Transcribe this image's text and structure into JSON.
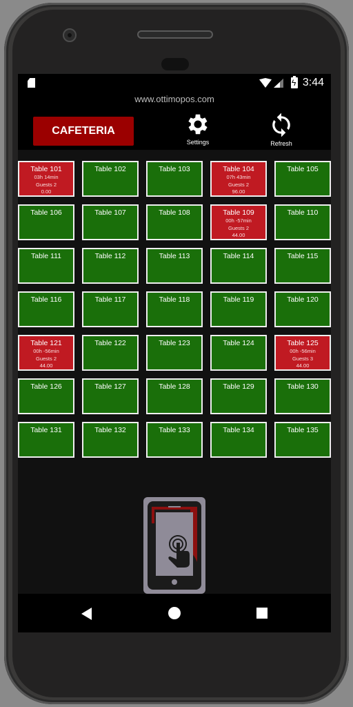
{
  "status_bar": {
    "time": "3:44",
    "icons": [
      "sd-card-icon",
      "wifi-icon",
      "signal-icon",
      "battery-charging-icon"
    ]
  },
  "header": {
    "site_url": "www.ottimopos.com",
    "section_button": "CAFETERIA",
    "settings_label": "Settings",
    "refresh_label": "Refresh"
  },
  "colors": {
    "free_table": "#1a6f0a",
    "occupied_table": "#c01a22",
    "section_button": "#9b0000"
  },
  "tables": [
    {
      "name": "Table 101",
      "status": "occupied",
      "time": "03h 14min",
      "guests": "Guests 2",
      "amount": "0.00"
    },
    {
      "name": "Table 102",
      "status": "free"
    },
    {
      "name": "Table 103",
      "status": "free"
    },
    {
      "name": "Table 104",
      "status": "occupied",
      "time": "07h 43min",
      "guests": "Guests 2",
      "amount": "96.00"
    },
    {
      "name": "Table 105",
      "status": "free"
    },
    {
      "name": "Table 106",
      "status": "free"
    },
    {
      "name": "Table 107",
      "status": "free"
    },
    {
      "name": "Table 108",
      "status": "free"
    },
    {
      "name": "Table 109",
      "status": "occupied",
      "time": "00h -57min",
      "guests": "Guests 2",
      "amount": "44.00"
    },
    {
      "name": "Table 110",
      "status": "free"
    },
    {
      "name": "Table 111",
      "status": "free"
    },
    {
      "name": "Table 112",
      "status": "free"
    },
    {
      "name": "Table 113",
      "status": "free"
    },
    {
      "name": "Table 114",
      "status": "free"
    },
    {
      "name": "Table 115",
      "status": "free"
    },
    {
      "name": "Table 116",
      "status": "free"
    },
    {
      "name": "Table 117",
      "status": "free"
    },
    {
      "name": "Table 118",
      "status": "free"
    },
    {
      "name": "Table 119",
      "status": "free"
    },
    {
      "name": "Table 120",
      "status": "free"
    },
    {
      "name": "Table 121",
      "status": "occupied",
      "time": "00h -56min",
      "guests": "Guests 2",
      "amount": "44.00"
    },
    {
      "name": "Table 122",
      "status": "free"
    },
    {
      "name": "Table 123",
      "status": "free"
    },
    {
      "name": "Table 124",
      "status": "free"
    },
    {
      "name": "Table 125",
      "status": "occupied",
      "time": "00h -56min",
      "guests": "Guests 3",
      "amount": "44.00"
    },
    {
      "name": "Table 126",
      "status": "free"
    },
    {
      "name": "Table 127",
      "status": "free"
    },
    {
      "name": "Table 128",
      "status": "free"
    },
    {
      "name": "Table 129",
      "status": "free"
    },
    {
      "name": "Table 130",
      "status": "free"
    },
    {
      "name": "Table 131",
      "status": "free"
    },
    {
      "name": "Table 132",
      "status": "free"
    },
    {
      "name": "Table 133",
      "status": "free"
    },
    {
      "name": "Table 134",
      "status": "free"
    },
    {
      "name": "Table 135",
      "status": "free"
    }
  ],
  "logo": {
    "icon": "phone-fork-touch-logo"
  },
  "nav_bar": {
    "buttons": [
      "back",
      "home",
      "recents"
    ]
  }
}
